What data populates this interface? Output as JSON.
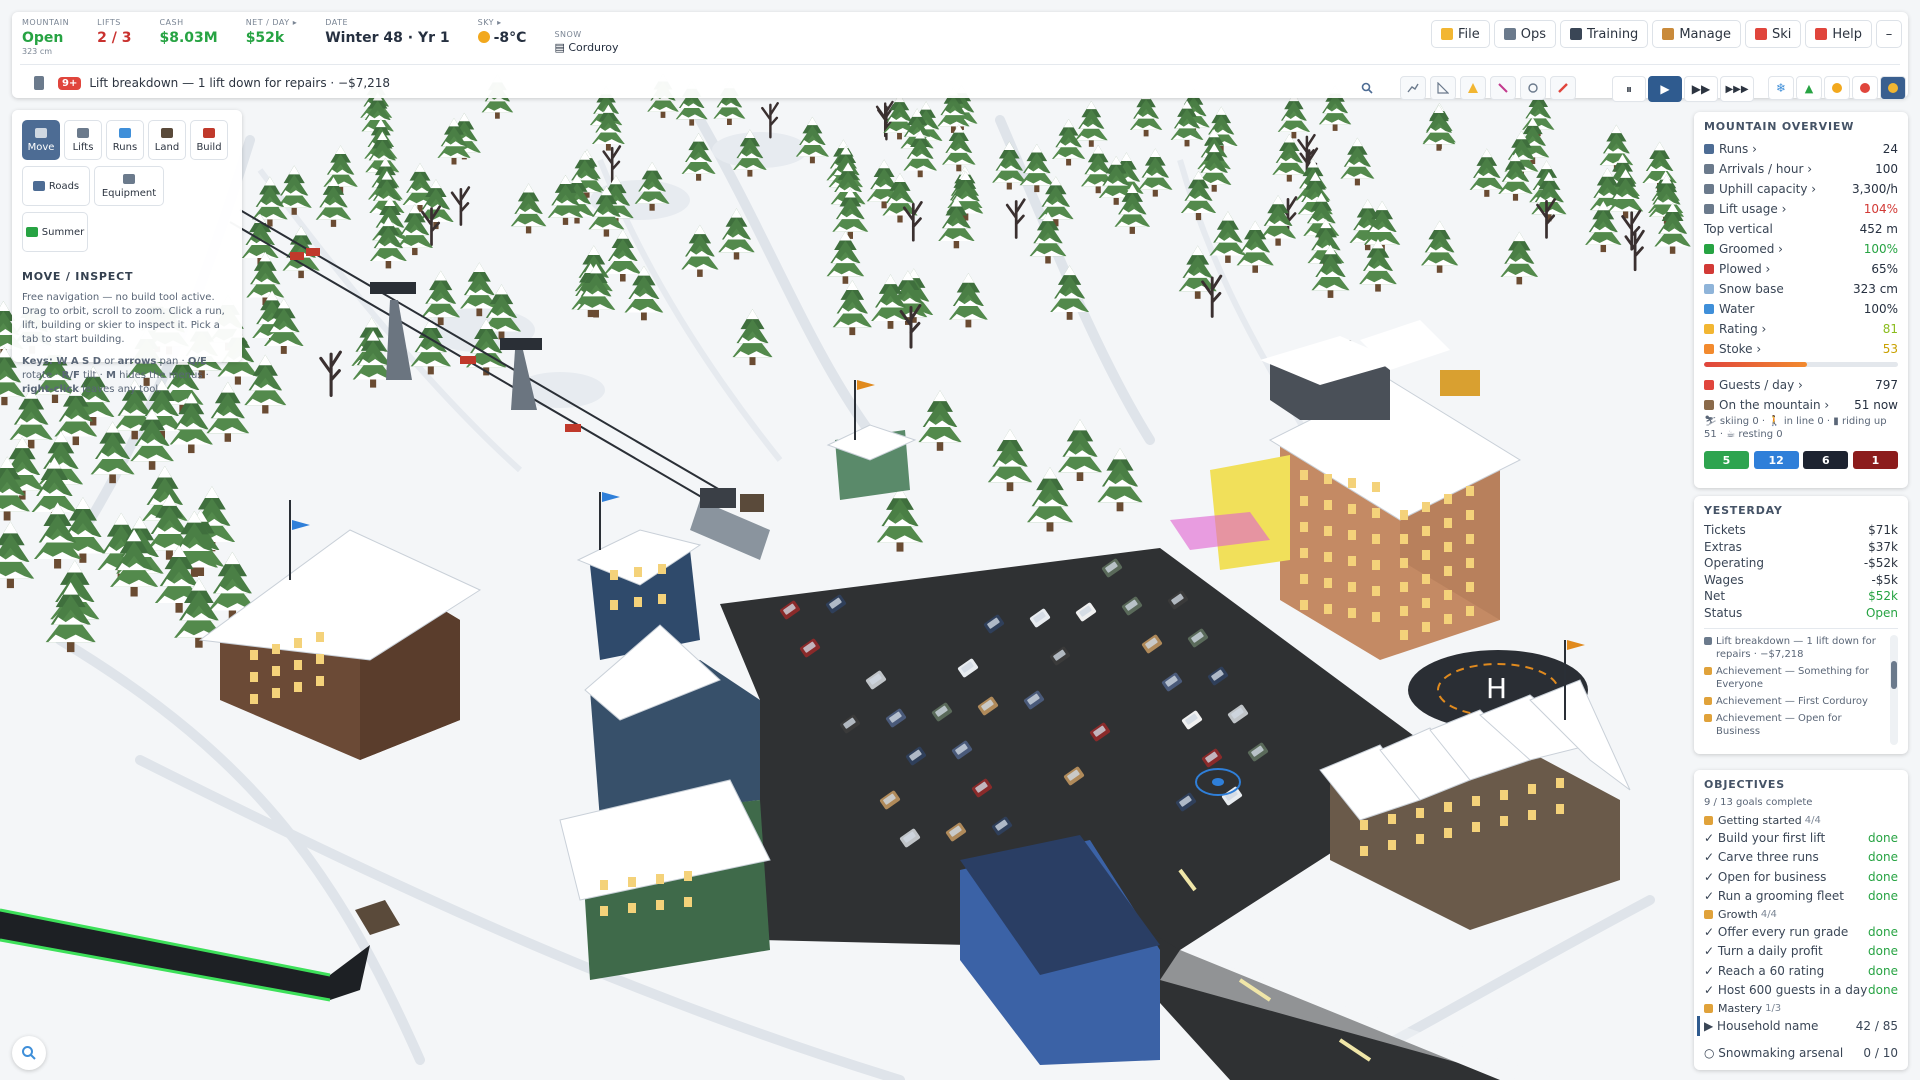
{
  "topbar": {
    "stats": [
      {
        "label": "MOUNTAIN",
        "value": "Open",
        "sub": "323 cm",
        "tone": "green"
      },
      {
        "label": "LIFTS",
        "value": "2 / 3",
        "sub": "",
        "tone": "red"
      },
      {
        "label": "CASH",
        "value": "$8.03M",
        "sub": "",
        "tone": "green"
      },
      {
        "label": "NET / DAY ▸",
        "value": "$52k",
        "sub": "",
        "tone": "green"
      },
      {
        "label": "DATE",
        "value": "Winter 48 · Yr 1",
        "sub": "",
        "tone": ""
      },
      {
        "label": "SKY ▸",
        "value": "-8°C",
        "sub": "",
        "tone": "",
        "icon": "sun-icon"
      }
    ],
    "snow": {
      "label": "SNOW",
      "value": "Corduroy"
    },
    "menu": [
      {
        "label": "File",
        "icon": "folder-icon",
        "color": "#f2b632"
      },
      {
        "label": "Ops",
        "icon": "tools-icon",
        "color": "#6b7a8c"
      },
      {
        "label": "Training",
        "icon": "graduation-cap-icon",
        "color": "#3a4656"
      },
      {
        "label": "Manage",
        "icon": "money-bag-icon",
        "color": "#c98a3a"
      },
      {
        "label": "Ski",
        "icon": "skier-icon",
        "color": "#e0453c"
      },
      {
        "label": "Help",
        "icon": "question-icon",
        "color": "#e0453c"
      }
    ],
    "minimize_label": "–",
    "alert": {
      "badge": "9+",
      "text": "Lift breakdown — 1 lift down for repairs · −$7,218"
    }
  },
  "tools": {
    "buttons": [
      {
        "label": "Move",
        "icon": "move-icon",
        "active": true
      },
      {
        "label": "Lifts",
        "icon": "lift-icon"
      },
      {
        "label": "Runs",
        "icon": "runs-icon"
      },
      {
        "label": "Land",
        "icon": "land-icon"
      },
      {
        "label": "Build",
        "icon": "build-icon"
      }
    ],
    "row2": [
      {
        "label": "Roads",
        "icon": "roads-icon"
      },
      {
        "label": "Equipment",
        "icon": "equipment-icon"
      },
      {
        "label": "Summer",
        "icon": "summer-icon"
      }
    ],
    "title": "MOVE / INSPECT",
    "description": "Free navigation — no build tool active. Drag to orbit, scroll to zoom. Click a run, lift, building or skier to inspect it. Pick a tab to start building.",
    "keys": {
      "a": "Keys: ",
      "b": "W A S D",
      "c": " or ",
      "d": "arrows",
      "e": " pan · ",
      "f": "Q/E",
      "g": " rotate · ",
      "h": "R/F",
      "i": " tilt · ",
      "j": "M",
      "k": " hides the menus · ",
      "l": "right-click",
      "m": " leaves any tool."
    }
  },
  "overview": {
    "title": "MOUNTAIN OVERVIEW",
    "rows": [
      {
        "label": "Runs ›",
        "value": "24",
        "tone": "",
        "color": "#4d6c94"
      },
      {
        "label": "Arrivals / hour ›",
        "value": "100",
        "tone": "",
        "color": "#6b7a8c"
      },
      {
        "label": "Uphill capacity ›",
        "value": "3,300/h",
        "tone": "",
        "color": "#6b7a8c"
      },
      {
        "label": "Lift usage ›",
        "value": "104%",
        "tone": "red",
        "color": "#6b7a8c"
      },
      {
        "label": "Top vertical",
        "value": "452 m",
        "tone": "",
        "color": ""
      },
      {
        "label": "Groomed ›",
        "value": "100%",
        "tone": "green",
        "color": "#27a343"
      },
      {
        "label": "Plowed ›",
        "value": "65%",
        "tone": "",
        "color": "#d23a36"
      },
      {
        "label": "Snow base",
        "value": "323 cm",
        "tone": "",
        "color": "#8fb4d9"
      },
      {
        "label": "Water",
        "value": "100%",
        "tone": "",
        "color": "#3f8fd9"
      },
      {
        "label": "Rating ›",
        "value": "81",
        "tone": "lime",
        "color": "#f2b632"
      },
      {
        "label": "Stoke ›",
        "value": "53",
        "tone": "warm",
        "color": "#f28a2e"
      }
    ],
    "stoke_level": 0.53,
    "guests": {
      "label": "Guests / day ›",
      "value": "797"
    },
    "onmountain": {
      "label": "On the mountain ›",
      "value": "51 now"
    },
    "breakdown": {
      "l1": "skiing 0 · ",
      "l2": "in line 0 · ",
      "l3": "riding up",
      "l4": "51 · ",
      "l5": "resting 0"
    },
    "counters": [
      {
        "value": "5",
        "color": "#2ea44f"
      },
      {
        "value": "12",
        "color": "#2f7fd9"
      },
      {
        "value": "6",
        "color": "#1d2330"
      },
      {
        "value": "1",
        "color": "#8c1c1c"
      }
    ]
  },
  "yesterday": {
    "title": "YESTERDAY",
    "rows": [
      {
        "label": "Tickets",
        "value": "$71k",
        "tone": ""
      },
      {
        "label": "Extras",
        "value": "$37k",
        "tone": ""
      },
      {
        "label": "Operating",
        "value": "-$52k",
        "tone": ""
      },
      {
        "label": "Wages",
        "value": "-$5k",
        "tone": ""
      },
      {
        "label": "Net",
        "value": "$52k",
        "tone": "green"
      },
      {
        "label": "Status",
        "value": "Open",
        "tone": "green"
      }
    ],
    "log": [
      {
        "text": "Lift breakdown — 1 lift down for repairs · −$7,218",
        "kind": "lift"
      },
      {
        "text": "Achievement — Something for Everyone",
        "kind": "ach"
      },
      {
        "text": "Achievement — First Corduroy",
        "kind": "ach"
      },
      {
        "text": "Achievement — Open for Business",
        "kind": "ach"
      }
    ]
  },
  "objectives": {
    "title": "OBJECTIVES",
    "summary": "9 / 13 goals complete",
    "groups": [
      {
        "name": "Getting started",
        "count": "4/4",
        "goals": [
          {
            "label": "✓ Build your first lift",
            "status": "done"
          },
          {
            "label": "✓ Carve three runs",
            "status": "done"
          },
          {
            "label": "✓ Open for business",
            "status": "done"
          },
          {
            "label": "✓ Run a grooming fleet",
            "status": "done"
          }
        ]
      },
      {
        "name": "Growth",
        "count": "4/4",
        "goals": [
          {
            "label": "✓ Offer every run grade",
            "status": "done"
          },
          {
            "label": "✓ Turn a daily profit",
            "status": "done"
          },
          {
            "label": "✓ Reach a 60 rating",
            "status": "done"
          },
          {
            "label": "✓ Host 600 guests in a day",
            "status": "done"
          }
        ]
      },
      {
        "name": "Mastery",
        "count": "1/3",
        "goals": [
          {
            "label": "▶ Household name",
            "status": "42 / 85"
          },
          {
            "label": "○ Snowmaking arsenal",
            "status": "0 / 10"
          }
        ]
      }
    ]
  },
  "colors": {
    "snow": "#f4f6f8",
    "tree": "#4a7a44",
    "asphalt": "#2f3133",
    "accent": "#2f5b8f"
  }
}
